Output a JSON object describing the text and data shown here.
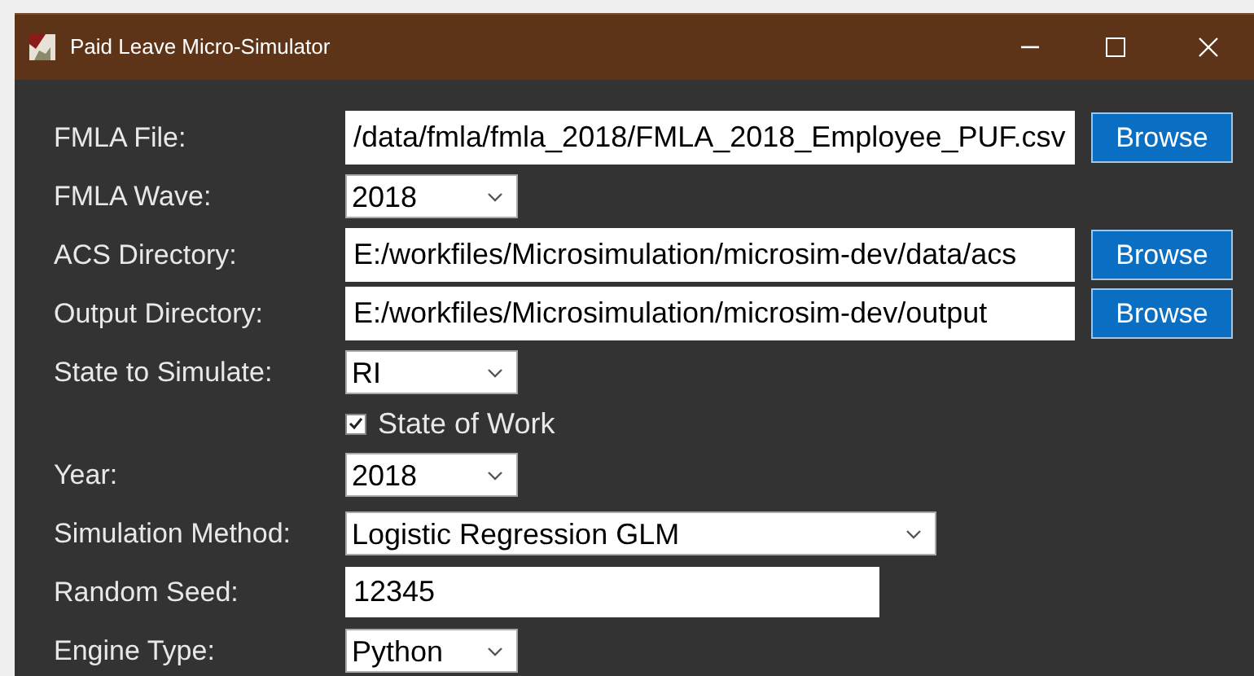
{
  "window": {
    "title": "Paid Leave Micro-Simulator"
  },
  "rows": [
    {
      "kind": "path",
      "label": "FMLA File:",
      "value": "/data/fmla/fmla_2018/FMLA_2018_Employee_PUF.csv",
      "button": "Browse"
    },
    {
      "kind": "select",
      "label": "FMLA Wave:",
      "value": "2018"
    },
    {
      "kind": "path",
      "label": "ACS Directory:",
      "value": "E:/workfiles/Microsimulation/microsim-dev/data/acs",
      "button": "Browse"
    },
    {
      "kind": "path",
      "label": "Output Directory:",
      "value": "E:/workfiles/Microsimulation/microsim-dev/output",
      "button": "Browse"
    },
    {
      "kind": "select",
      "label": "State to Simulate:",
      "value": "RI"
    },
    {
      "kind": "checkbox",
      "label": "State of Work",
      "checked": true
    },
    {
      "kind": "select",
      "label": "Year:",
      "value": "2018"
    },
    {
      "kind": "wideselect",
      "label": "Simulation Method:",
      "value": "Logistic Regression GLM"
    },
    {
      "kind": "text",
      "label": "Random Seed:",
      "value": "12345"
    },
    {
      "kind": "select",
      "label": "Engine Type:",
      "value": "Python"
    }
  ]
}
